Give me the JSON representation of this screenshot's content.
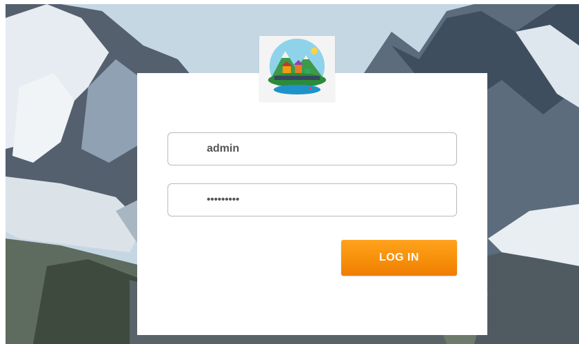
{
  "background": {
    "scene": "snowy-mountain-range"
  },
  "logo": {
    "icon": "island-village-logo-icon"
  },
  "login_form": {
    "username": {
      "value": "admin",
      "placeholder": ""
    },
    "password": {
      "value": "•••••••••",
      "placeholder": ""
    },
    "submit_label": "LOG IN"
  },
  "colors": {
    "button": "#f7900a",
    "card": "#ffffff",
    "field_border": "#b9b9b9"
  }
}
